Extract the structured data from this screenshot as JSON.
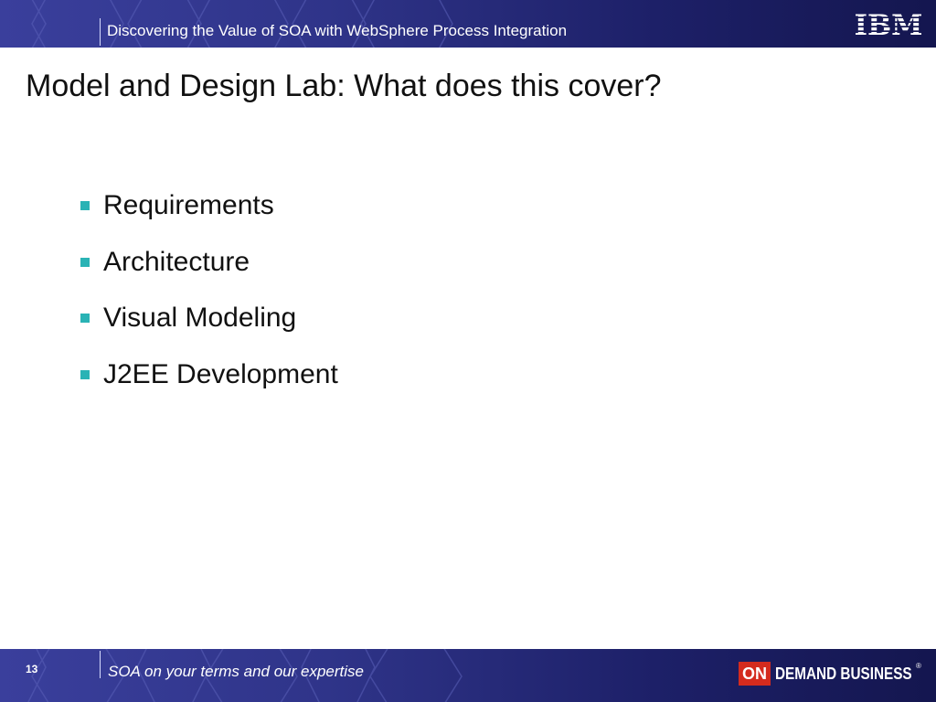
{
  "header": {
    "title": "Discovering the Value of SOA with WebSphere Process Integration",
    "logo_text": "IBM"
  },
  "slide": {
    "title": "Model and Design Lab: What does this cover?",
    "bullets": [
      "Requirements",
      "Architecture",
      "Visual Modeling",
      "J2EE Development"
    ]
  },
  "footer": {
    "page_number": "13",
    "tagline": "SOA on your terms and our expertise",
    "logo": {
      "on": "ON",
      "text": "DEMAND BUSINESS",
      "mark": "®"
    }
  },
  "colors": {
    "band_light": "#3a3f9c",
    "band_dark": "#14164f",
    "bullet_accent": "#2ab3b5",
    "on_red": "#d42b1e"
  }
}
